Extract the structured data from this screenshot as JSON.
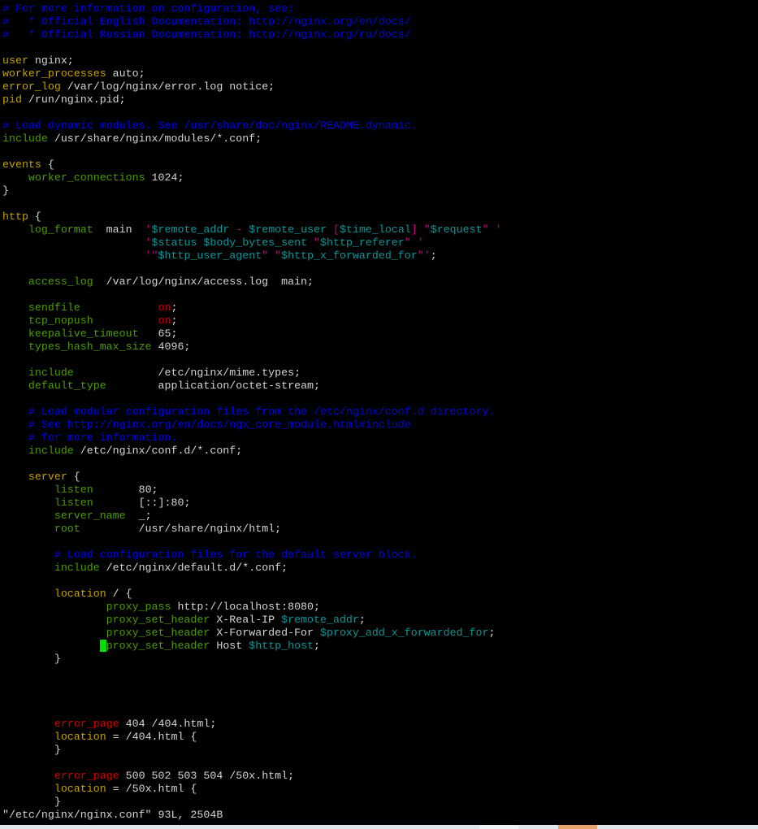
{
  "colors": {
    "comment": "#0000ee",
    "keyword": "#c4a000",
    "directive": "#4e9a06",
    "string": "#c4007f",
    "variable": "#06989a",
    "value_on": "#cc0000",
    "text": "#d3d7cf",
    "cursor": "#00e000",
    "background": "#000000"
  },
  "editor": {
    "lines": [
      [
        [
          "cm",
          "# For more information on configuration, see:"
        ]
      ],
      [
        [
          "cm",
          "#   * Official English Documentation: http://nginx.org/en/docs/"
        ]
      ],
      [
        [
          "cm",
          "#   * Official Russian Documentation: http://nginx.org/ru/docs/"
        ]
      ],
      [],
      [
        [
          "kw",
          "user"
        ],
        [
          "plain",
          " nginx;"
        ]
      ],
      [
        [
          "kw",
          "worker_processes"
        ],
        [
          "plain",
          " auto;"
        ]
      ],
      [
        [
          "kw",
          "error_log"
        ],
        [
          "plain",
          " /var/log/nginx/error.log notice;"
        ]
      ],
      [
        [
          "kw",
          "pid"
        ],
        [
          "plain",
          " /run/nginx.pid;"
        ]
      ],
      [],
      [
        [
          "cm",
          "# Load dynamic modules. See /usr/share/doc/nginx/README.dynamic."
        ]
      ],
      [
        [
          "dir",
          "include"
        ],
        [
          "plain",
          " /usr/share/nginx/modules/*.conf;"
        ]
      ],
      [],
      [
        [
          "kw",
          "events"
        ],
        [
          "plain",
          " {"
        ]
      ],
      [
        [
          "plain",
          "    "
        ],
        [
          "dir",
          "worker_connections"
        ],
        [
          "plain",
          " 1024;"
        ]
      ],
      [
        [
          "plain",
          "}"
        ]
      ],
      [],
      [
        [
          "kw",
          "http"
        ],
        [
          "plain",
          " {"
        ]
      ],
      [
        [
          "plain",
          "    "
        ],
        [
          "dir",
          "log_format"
        ],
        [
          "plain",
          "  main  "
        ],
        [
          "str",
          "'"
        ],
        [
          "var",
          "$remote_addr"
        ],
        [
          "str",
          " - "
        ],
        [
          "var",
          "$remote_user"
        ],
        [
          "str",
          " ["
        ],
        [
          "var",
          "$time_local"
        ],
        [
          "str",
          "] \""
        ],
        [
          "var",
          "$request"
        ],
        [
          "str",
          "\" '"
        ]
      ],
      [
        [
          "plain",
          "                      "
        ],
        [
          "str",
          "'"
        ],
        [
          "var",
          "$status"
        ],
        [
          "str",
          " "
        ],
        [
          "var",
          "$body_bytes_sent"
        ],
        [
          "str",
          " \""
        ],
        [
          "var",
          "$http_referer"
        ],
        [
          "str",
          "\" '"
        ]
      ],
      [
        [
          "plain",
          "                      "
        ],
        [
          "str",
          "'\""
        ],
        [
          "var",
          "$http_user_agent"
        ],
        [
          "str",
          "\" \""
        ],
        [
          "var",
          "$http_x_forwarded_for"
        ],
        [
          "str",
          "\"'"
        ],
        [
          "plain",
          ";"
        ]
      ],
      [],
      [
        [
          "plain",
          "    "
        ],
        [
          "dir",
          "access_log"
        ],
        [
          "plain",
          "  /var/log/nginx/access.log  main;"
        ]
      ],
      [],
      [
        [
          "plain",
          "    "
        ],
        [
          "dir",
          "sendfile"
        ],
        [
          "plain",
          "            "
        ],
        [
          "on",
          "on"
        ],
        [
          "plain",
          ";"
        ]
      ],
      [
        [
          "plain",
          "    "
        ],
        [
          "dir",
          "tcp_nopush"
        ],
        [
          "plain",
          "          "
        ],
        [
          "on",
          "on"
        ],
        [
          "plain",
          ";"
        ]
      ],
      [
        [
          "plain",
          "    "
        ],
        [
          "dir",
          "keepalive_timeout"
        ],
        [
          "plain",
          "   65;"
        ]
      ],
      [
        [
          "plain",
          "    "
        ],
        [
          "dir",
          "types_hash_max_size"
        ],
        [
          "plain",
          " 4096;"
        ]
      ],
      [],
      [
        [
          "plain",
          "    "
        ],
        [
          "dir",
          "include"
        ],
        [
          "plain",
          "             /etc/nginx/mime.types;"
        ]
      ],
      [
        [
          "plain",
          "    "
        ],
        [
          "dir",
          "default_type"
        ],
        [
          "plain",
          "        application/octet-stream;"
        ]
      ],
      [],
      [
        [
          "plain",
          "    "
        ],
        [
          "cm",
          "# Load modular configuration files from the /etc/nginx/conf.d directory."
        ]
      ],
      [
        [
          "plain",
          "    "
        ],
        [
          "cm",
          "# See http://nginx.org/en/docs/ngx_core_module.html#include"
        ]
      ],
      [
        [
          "plain",
          "    "
        ],
        [
          "cm",
          "# for more information."
        ]
      ],
      [
        [
          "plain",
          "    "
        ],
        [
          "dir",
          "include"
        ],
        [
          "plain",
          " /etc/nginx/conf.d/*.conf;"
        ]
      ],
      [],
      [
        [
          "plain",
          "    "
        ],
        [
          "kw",
          "server"
        ],
        [
          "plain",
          " {"
        ]
      ],
      [
        [
          "plain",
          "        "
        ],
        [
          "dir",
          "listen"
        ],
        [
          "plain",
          "       80;"
        ]
      ],
      [
        [
          "plain",
          "        "
        ],
        [
          "dir",
          "listen"
        ],
        [
          "plain",
          "       [::]:80;"
        ]
      ],
      [
        [
          "plain",
          "        "
        ],
        [
          "dir",
          "server_name"
        ],
        [
          "plain",
          "  _;"
        ]
      ],
      [
        [
          "plain",
          "        "
        ],
        [
          "dir",
          "root"
        ],
        [
          "plain",
          "         /usr/share/nginx/html;"
        ]
      ],
      [],
      [
        [
          "plain",
          "        "
        ],
        [
          "cm",
          "# Load configuration files for the default server block."
        ]
      ],
      [
        [
          "plain",
          "        "
        ],
        [
          "dir",
          "include"
        ],
        [
          "plain",
          " /etc/nginx/default.d/*.conf;"
        ]
      ],
      [],
      [
        [
          "plain",
          "        "
        ],
        [
          "kw",
          "location"
        ],
        [
          "plain",
          " / {"
        ]
      ],
      [
        [
          "plain",
          "                "
        ],
        [
          "dir",
          "proxy_pass"
        ],
        [
          "plain",
          " http://localhost:8080;"
        ]
      ],
      [
        [
          "plain",
          "                "
        ],
        [
          "dir",
          "proxy_set_header"
        ],
        [
          "plain",
          " X-Real-IP "
        ],
        [
          "var",
          "$remote_addr"
        ],
        [
          "plain",
          ";"
        ]
      ],
      [
        [
          "plain",
          "                "
        ],
        [
          "dir",
          "proxy_set_header"
        ],
        [
          "plain",
          " X-Forwarded-For "
        ],
        [
          "var",
          "$proxy_add_x_forwarded_for"
        ],
        [
          "plain",
          ";"
        ]
      ],
      [
        [
          "plain",
          "               "
        ],
        [
          "cursor",
          " "
        ],
        [
          "dir",
          "proxy_set_header"
        ],
        [
          "plain",
          " Host "
        ],
        [
          "var",
          "$http_host"
        ],
        [
          "plain",
          ";"
        ]
      ],
      [
        [
          "plain",
          "        }"
        ]
      ],
      [],
      [],
      [],
      [],
      [
        [
          "plain",
          "        "
        ],
        [
          "red",
          "error_page"
        ],
        [
          "plain",
          " 404 /404.html;"
        ]
      ],
      [
        [
          "plain",
          "        "
        ],
        [
          "kw",
          "location"
        ],
        [
          "plain",
          " = /404.html {"
        ]
      ],
      [
        [
          "plain",
          "        }"
        ]
      ],
      [],
      [
        [
          "plain",
          "        "
        ],
        [
          "red",
          "error_page"
        ],
        [
          "plain",
          " 500 502 503 504 /50x.html;"
        ]
      ],
      [
        [
          "plain",
          "        "
        ],
        [
          "kw",
          "location"
        ],
        [
          "plain",
          " = /50x.html {"
        ]
      ],
      [
        [
          "plain",
          "        }"
        ]
      ]
    ]
  },
  "status": {
    "text": "\"/etc/nginx/nginx.conf\" 93L, 2504B"
  }
}
